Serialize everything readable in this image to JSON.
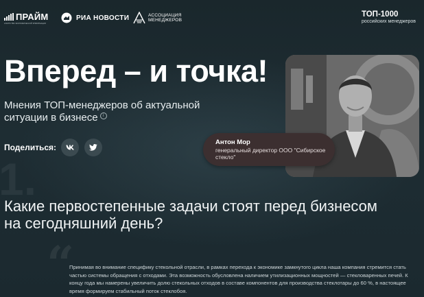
{
  "header": {
    "prime": {
      "name": "ПРАЙМ",
      "tagline": "АГЕНТСТВО ЭКОНОМИЧЕСКОЙ ИНФОРМАЦИИ"
    },
    "ria": {
      "name": "РИА НОВОСТИ"
    },
    "association": {
      "line1": "АССОЦИАЦИЯ",
      "line2": "МЕНЕДЖЕРОВ"
    },
    "top1000": {
      "title": "ТОП-1000",
      "subtitle": "российских менеджеров"
    }
  },
  "hero": {
    "title": "Вперед – и точка!",
    "subtitle": "Мнения ТОП-менеджеров об актуальной ситуации в бизнесе",
    "info_icon": "info-icon",
    "share_label": "Поделиться:",
    "share_buttons": [
      {
        "name": "vk",
        "icon": "vk-icon"
      },
      {
        "name": "twitter",
        "icon": "twitter-icon"
      }
    ]
  },
  "person": {
    "name": "Антон Мор",
    "role": "генеральный директор ООО \"Сибирское стекло\""
  },
  "section": {
    "number": "1.",
    "question": "Какие первостепенные задачи стоят перед бизнесом на сегодняшний день?",
    "answer": "Принимая во внимание специфику стекольной отрасли, в рамках перехода к экономике замкнутого цикла наша компания стремится стать частью системы обращения с отходами. Эта возможность обусловлена наличием утилизационных мощностей — стекловаренных печей. К концу года мы намерены увеличить долю стекольных отходов в составе компонентов для производства стеклотары до 60 %, в настоящее время формируем стабильный поток стеклобоя."
  },
  "colors": {
    "background": "#1c2a30",
    "caption_bg": "#3c2f30",
    "social_bg": "#3b4a50"
  }
}
